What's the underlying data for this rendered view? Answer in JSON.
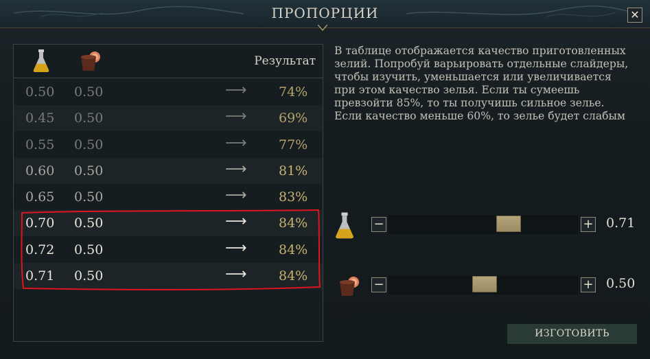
{
  "window": {
    "title": "ПРОПОРЦИИ",
    "close_label": "✕"
  },
  "table": {
    "column_icons": [
      "potion-flask-icon",
      "ingredient-pot-icon"
    ],
    "result_header": "Результат",
    "arrow": "⟶",
    "rows": [
      {
        "v1": "0.50",
        "v2": "0.50",
        "result": "74%"
      },
      {
        "v1": "0.45",
        "v2": "0.50",
        "result": "69%"
      },
      {
        "v1": "0.55",
        "v2": "0.50",
        "result": "77%"
      },
      {
        "v1": "0.60",
        "v2": "0.50",
        "result": "81%"
      },
      {
        "v1": "0.65",
        "v2": "0.50",
        "result": "83%"
      },
      {
        "v1": "0.70",
        "v2": "0.50",
        "result": "84%"
      },
      {
        "v1": "0.72",
        "v2": "0.50",
        "result": "84%"
      },
      {
        "v1": "0.71",
        "v2": "0.50",
        "result": "84%"
      }
    ]
  },
  "description": "В таблице отображается качество приготовленных зелий. Попробуй варьировать отдельные слайдеры, чтобы изучить, уменьшается или увеличивается при этом качество зелья. Если ты сумеешь превзойти 85%, то ты получишь сильное зелье. Если качество меньше 60%, то зелье будет слабым",
  "sliders": [
    {
      "icon": "potion-flask-icon",
      "minus": "−",
      "plus": "+",
      "value": "0.71",
      "level": 0.71
    },
    {
      "icon": "ingredient-pot-icon",
      "minus": "−",
      "plus": "+",
      "value": "0.50",
      "level": 0.5
    }
  ],
  "craft_button": "ИЗГОТОВИТЬ",
  "colors": {
    "result_gold": "#c7b370",
    "highlight_red": "#e0141e",
    "button_green": "#2a3b36"
  }
}
